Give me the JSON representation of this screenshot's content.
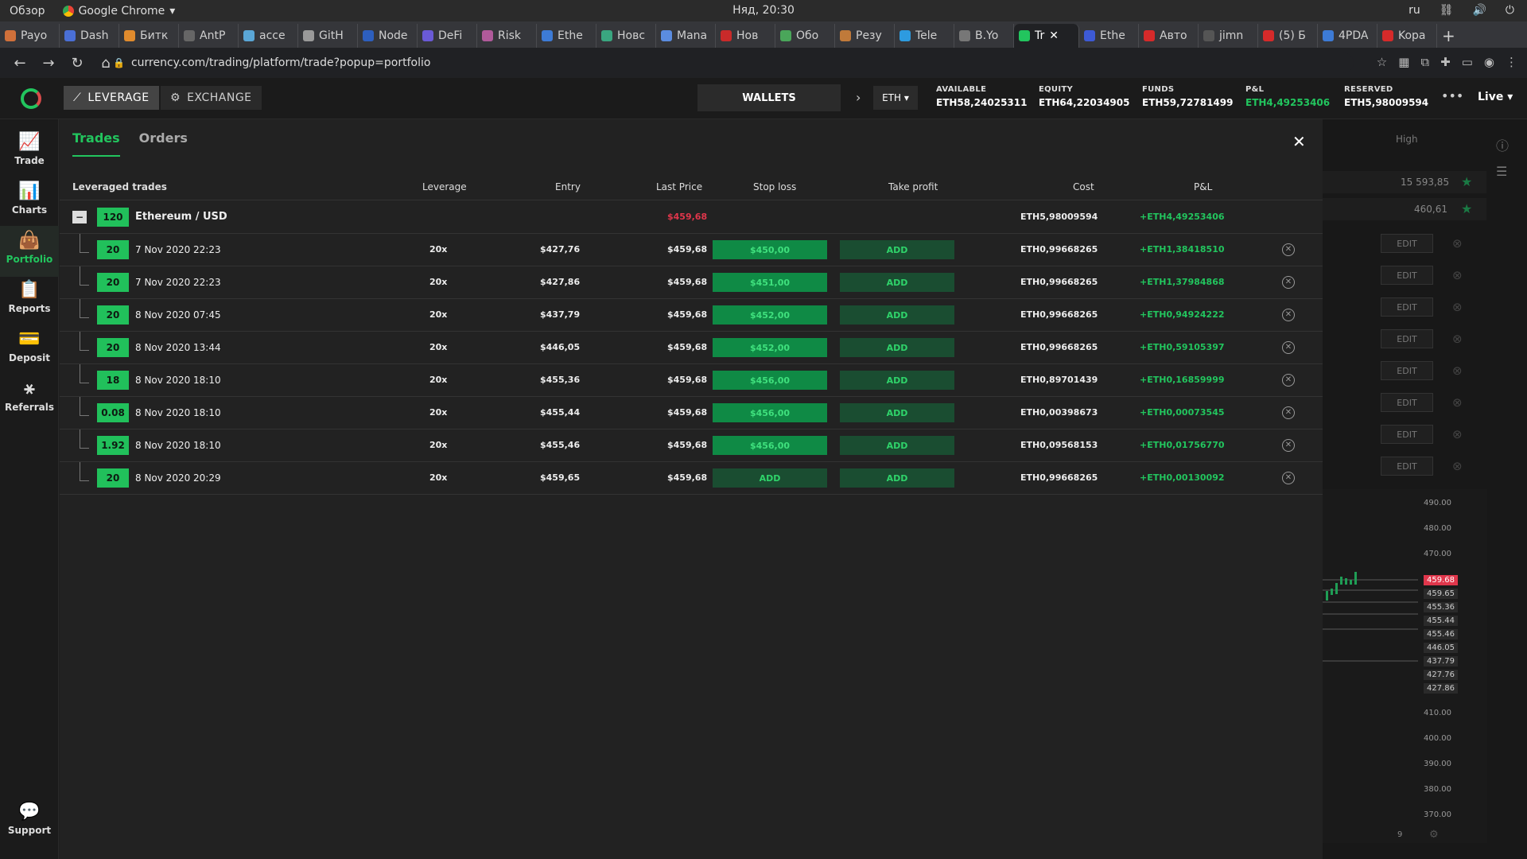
{
  "os": {
    "overview": "Обзор",
    "app": "Google Chrome",
    "clock": "Няд, 20:30",
    "lang": "ru"
  },
  "browser": {
    "tabs": [
      "Payo",
      "Dash",
      "Битк",
      "AntP",
      "acce",
      "GitH",
      "Node",
      "DeFi",
      "Risk",
      "Ethe",
      "Новс",
      "Mana",
      "Нов",
      "Обо",
      "Резу",
      "Tele",
      "B.Yo",
      "Tr",
      "Ethe",
      "Авто",
      "jimn",
      "(5) Б",
      "4PDA",
      "Kopa"
    ],
    "url": "currency.com/trading/platform/trade?popup=portfolio"
  },
  "header": {
    "leverage_label": "LEVERAGE",
    "exchange_label": "EXCHANGE",
    "wallets_label": "WALLETS",
    "currency": "ETH",
    "stats": [
      {
        "label": "AVAILABLE",
        "value": "ETH58,24025311"
      },
      {
        "label": "EQUITY",
        "value": "ETH64,22034905"
      },
      {
        "label": "FUNDS",
        "value": "ETH59,72781499"
      },
      {
        "label": "P&L",
        "value": "ETH4,49253406"
      },
      {
        "label": "RESERVED",
        "value": "ETH5,98009594"
      }
    ],
    "more": "•••",
    "live": "Live"
  },
  "sidebar": [
    {
      "label": "Trade",
      "icon": "trade-icon"
    },
    {
      "label": "Charts",
      "icon": "charts-icon"
    },
    {
      "label": "Portfolio",
      "icon": "portfolio-icon"
    },
    {
      "label": "Reports",
      "icon": "reports-icon"
    },
    {
      "label": "Deposit",
      "icon": "deposit-icon"
    },
    {
      "label": "Referrals",
      "icon": "referrals-icon"
    },
    {
      "label": "Support",
      "icon": "support-icon"
    }
  ],
  "panel": {
    "tabs": [
      "Trades",
      "Orders"
    ],
    "columns": {
      "name": "Leveraged trades",
      "leverage": "Leverage",
      "entry": "Entry",
      "last": "Last Price",
      "sl": "Stop loss",
      "tp": "Take profit",
      "cost": "Cost",
      "pnl": "P&L"
    },
    "group": {
      "qty": "120",
      "name": "Ethereum / USD",
      "last": "$459,68",
      "cost": "ETH5,98009594",
      "pnl": "+ETH4,49253406"
    },
    "trades": [
      {
        "qty": "20",
        "date": "7 Nov 2020 22:23",
        "lev": "20x",
        "entry": "$427,76",
        "last": "$459,68",
        "sl": "$450,00",
        "tp": "ADD",
        "cost": "ETH0,99668265",
        "pnl": "+ETH1,38418510"
      },
      {
        "qty": "20",
        "date": "7 Nov 2020 22:23",
        "lev": "20x",
        "entry": "$427,86",
        "last": "$459,68",
        "sl": "$451,00",
        "tp": "ADD",
        "cost": "ETH0,99668265",
        "pnl": "+ETH1,37984868"
      },
      {
        "qty": "20",
        "date": "8 Nov 2020 07:45",
        "lev": "20x",
        "entry": "$437,79",
        "last": "$459,68",
        "sl": "$452,00",
        "tp": "ADD",
        "cost": "ETH0,99668265",
        "pnl": "+ETH0,94924222"
      },
      {
        "qty": "20",
        "date": "8 Nov 2020 13:44",
        "lev": "20x",
        "entry": "$446,05",
        "last": "$459,68",
        "sl": "$452,00",
        "tp": "ADD",
        "cost": "ETH0,99668265",
        "pnl": "+ETH0,59105397"
      },
      {
        "qty": "18",
        "date": "8 Nov 2020 18:10",
        "lev": "20x",
        "entry": "$455,36",
        "last": "$459,68",
        "sl": "$456,00",
        "tp": "ADD",
        "cost": "ETH0,89701439",
        "pnl": "+ETH0,16859999"
      },
      {
        "qty": "0.08",
        "date": "8 Nov 2020 18:10",
        "lev": "20x",
        "entry": "$455,44",
        "last": "$459,68",
        "sl": "$456,00",
        "tp": "ADD",
        "cost": "ETH0,00398673",
        "pnl": "+ETH0,00073545"
      },
      {
        "qty": "1.92",
        "date": "8 Nov 2020 18:10",
        "lev": "20x",
        "entry": "$455,46",
        "last": "$459,68",
        "sl": "$456,00",
        "tp": "ADD",
        "cost": "ETH0,09568153",
        "pnl": "+ETH0,01756770"
      },
      {
        "qty": "20",
        "date": "8 Nov 2020 20:29",
        "lev": "20x",
        "entry": "$459,65",
        "last": "$459,68",
        "sl": "ADD",
        "tp": "ADD",
        "cost": "ETH0,99668265",
        "pnl": "+ETH0,00130092"
      }
    ]
  },
  "right": {
    "high_label": "High",
    "vals": [
      "15 593,85",
      "460,61"
    ],
    "edit_label": "EDIT",
    "price_labels": [
      "490.00",
      "480.00",
      "470.00",
      "459.68",
      "459.65",
      "455.36",
      "455.44",
      "455.46",
      "446.05",
      "437.79",
      "427.76",
      "427.86",
      "410.00",
      "400.00",
      "390.00",
      "380.00",
      "370.00"
    ],
    "footer": "9"
  }
}
